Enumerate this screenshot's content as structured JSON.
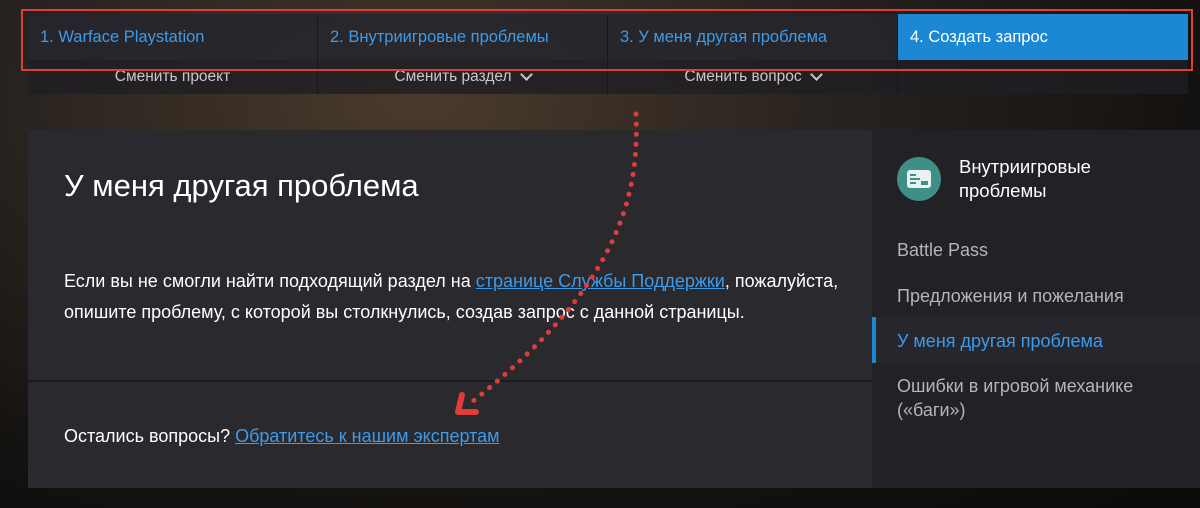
{
  "breadcrumb": {
    "steps": [
      {
        "label": "1. Warface Playstation"
      },
      {
        "label": "2. Внутриигровые проблемы"
      },
      {
        "label": "3. У меня другая проблема"
      },
      {
        "label": "4. Создать запрос"
      }
    ],
    "sub_links": [
      {
        "label": "Сменить проект"
      },
      {
        "label": "Сменить раздел"
      },
      {
        "label": "Сменить вопрос"
      }
    ]
  },
  "main": {
    "title": "У меня другая проблема",
    "body_pre": "Если вы не смогли найти подходящий раздел на ",
    "body_link": "странице Службы Поддержки",
    "body_post": ", пожалуйста, опишите проблему, с которой вы столкнулись, создав запрос с данной страницы.",
    "footer_pre": "Остались вопросы? ",
    "footer_link": "Обратитесь к нашим экспертам"
  },
  "sidebar": {
    "section_title": "Внутриигровые проблемы",
    "section_icon": "card-icon",
    "items": [
      {
        "label": "Battle Pass"
      },
      {
        "label": "Предложения и пожелания"
      },
      {
        "label": "У меня другая проблема",
        "active": true
      },
      {
        "label": "Ошибки в игровой механике («баги»)"
      }
    ]
  },
  "colors": {
    "accent": "#1c87d2",
    "link": "#3d9be9",
    "annotation": "#e03c3c",
    "card_bg": "#29292e",
    "sidebar_bg": "#212126",
    "icon_bg": "#3e8f86"
  }
}
